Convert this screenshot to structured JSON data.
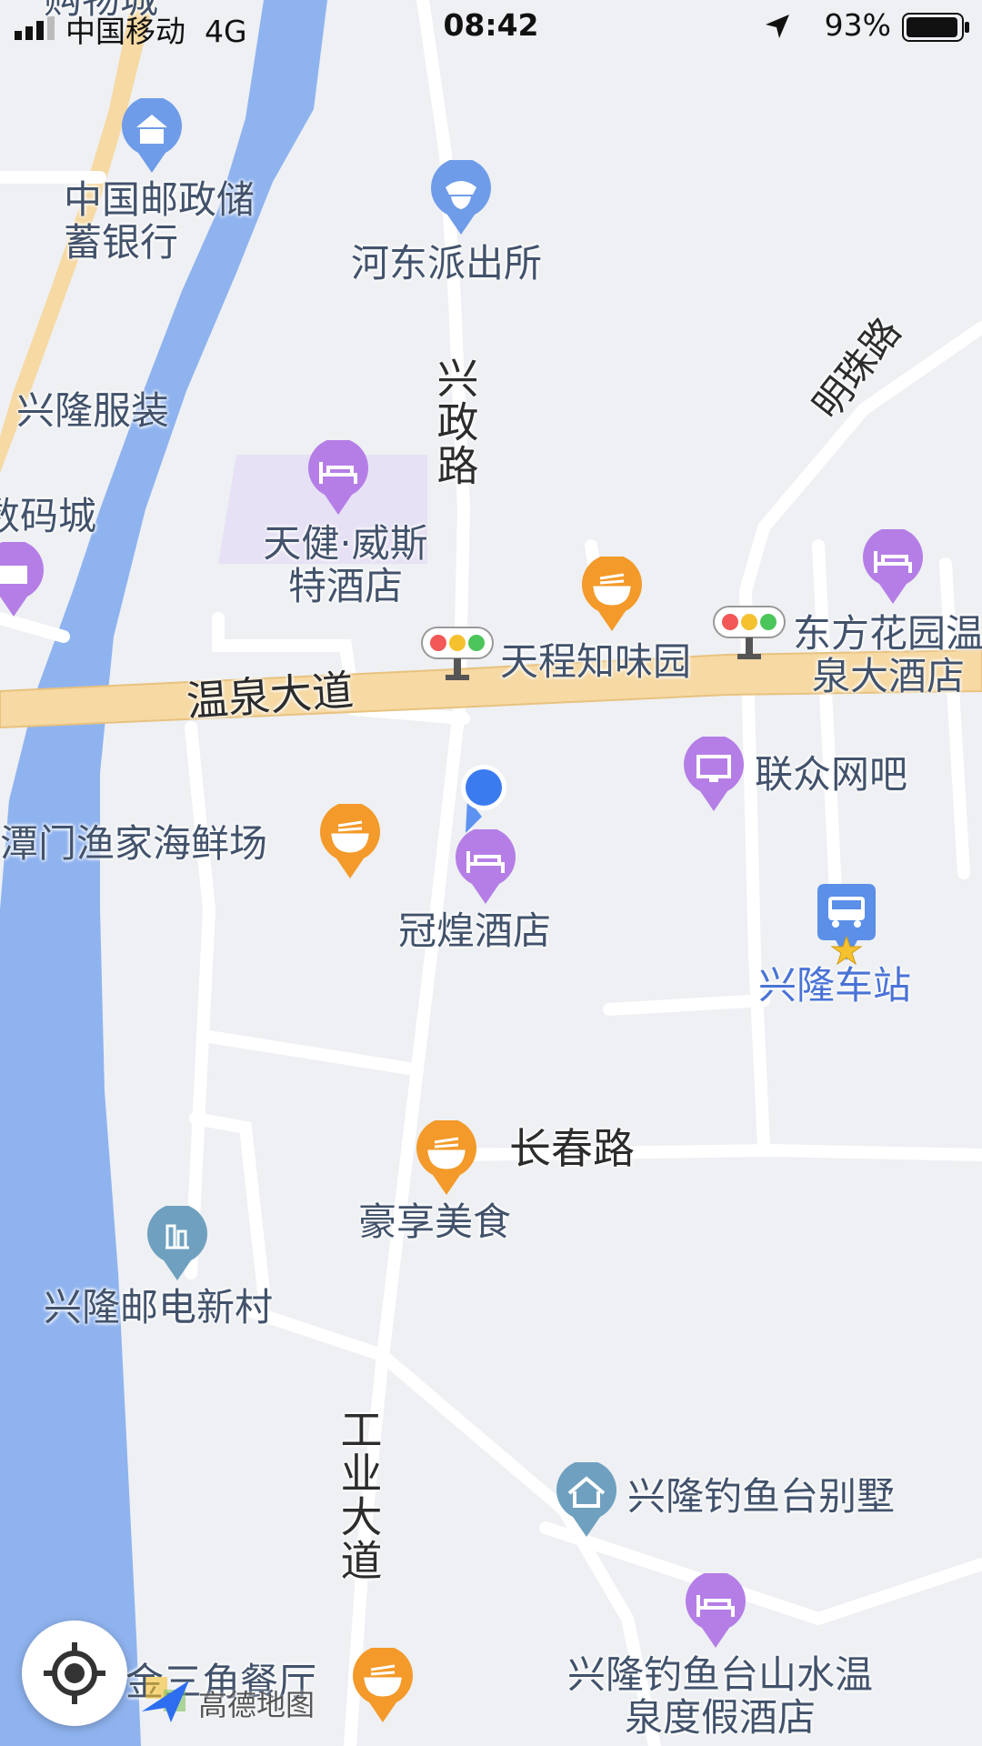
{
  "status_bar": {
    "carrier": "中国移动",
    "network": "4G",
    "time": "08:42",
    "battery": "93%"
  },
  "map": {
    "roads": {
      "wenquan": "温泉大道",
      "xingzheng": "兴政路",
      "mingzhu": "明珠路",
      "changchun": "长春路",
      "gongye": "工业大道"
    },
    "pois": {
      "top_cut": "购物城",
      "postal_bank": "中国邮政储蓄银行",
      "police": "河东派出所",
      "clothing": "兴隆服装",
      "digital": "数码城",
      "tianjian_hotel": "天健·威斯特酒店",
      "tiancheng": "天程知味园",
      "dongfang_hotel": "东方花园温泉大酒店",
      "lianzhong": "联众网吧",
      "seafood": "潭门渔家海鲜场",
      "guanhuang_hotel": "冠煌酒店",
      "bus_station": "兴隆车站",
      "haoxiang": "豪享美食",
      "youdian_village": "兴隆邮电新村",
      "fishing_villa": "兴隆钓鱼台别墅",
      "fishing_resort": "兴隆钓鱼台山水温泉度假酒店",
      "triangle_restaurant": "金三角餐厅"
    },
    "colors": {
      "river": "#8fb3ef",
      "main_road": "#f6d9a3",
      "minor_road": "#ffffff",
      "hotel_pin": "#b57ee6",
      "food_pin": "#f39a2a",
      "police_pin": "#6f9ce8",
      "bus_pin": "#5b8fe8",
      "location_dot": "#3a7bf0"
    }
  },
  "controls": {
    "locate_icon": "locate-icon",
    "brand": "高德地图"
  }
}
